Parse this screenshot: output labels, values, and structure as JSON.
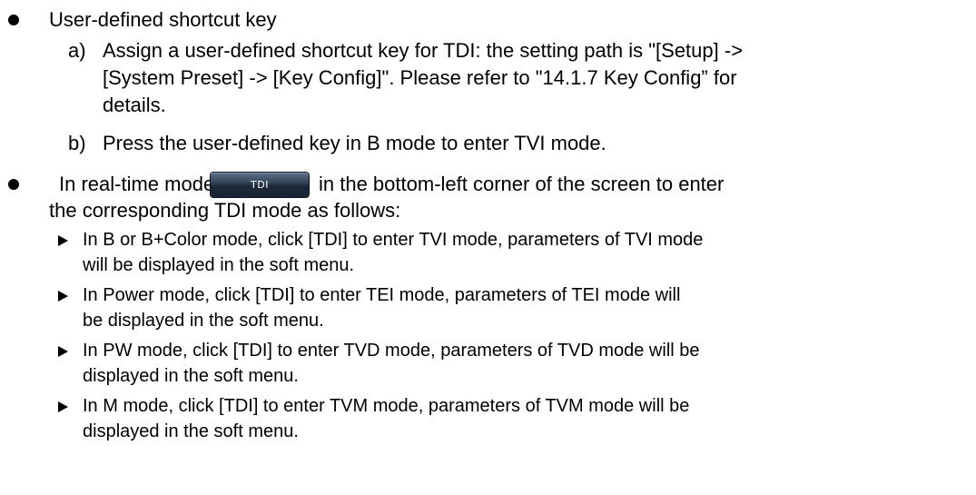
{
  "sections": [
    {
      "title": "User-defined shortcut key",
      "steps": [
        {
          "marker": "a)",
          "lines": [
            "Assign a user-defined shortcut key for TDI: the setting path is \"[Setup] ->",
            "[System Preset] -> [Key Config]\". Please refer to \"14.1.7 Key Config” for",
            "details."
          ]
        },
        {
          "marker": "b)",
          "lines": [
            "Press the user-defined key in B mode to enter TVI mode."
          ]
        }
      ]
    },
    {
      "intro_before_button": "In real-time mode, click",
      "button_label": "TDI",
      "intro_after_button": "in the bottom-left corner of the screen to enter",
      "intro_line2": "the corresponding TDI mode as follows:",
      "items": [
        {
          "lines": [
            "In B or B+Color mode, click [TDI] to enter TVI mode, parameters of TVI mode",
            "will be displayed in the soft menu."
          ]
        },
        {
          "lines": [
            "In Power mode, click [TDI] to enter TEI mode, parameters of TEI mode will",
            "be displayed in the soft menu."
          ]
        },
        {
          "lines": [
            "In PW mode, click [TDI] to enter TVD mode, parameters of TVD mode will be",
            "displayed in the soft menu."
          ]
        },
        {
          "lines": [
            "In M mode, click [TDI] to enter TVM mode, parameters of TVM mode will be",
            "displayed in the soft menu."
          ]
        }
      ]
    }
  ]
}
